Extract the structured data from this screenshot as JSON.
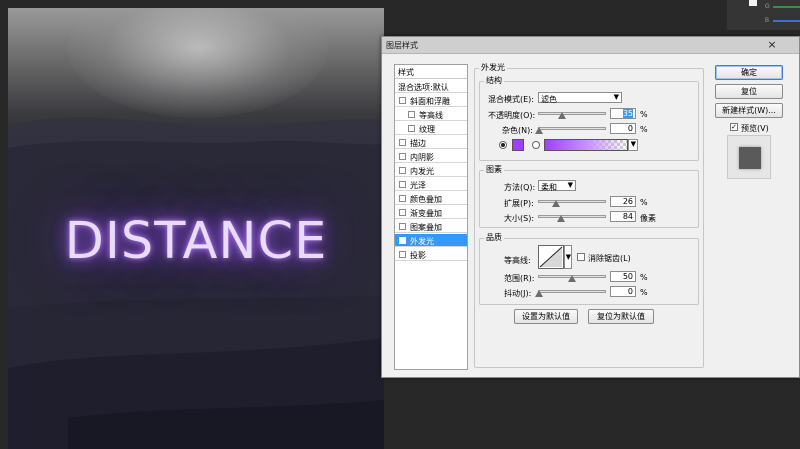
{
  "dialog": {
    "title": "图层样式",
    "close_glyph": "×"
  },
  "styles_panel": {
    "header": "样式",
    "items": [
      {
        "label": "混合选项:默认",
        "checked": false
      },
      {
        "label": "斜面和浮雕",
        "checked": false
      },
      {
        "label": "等高线",
        "checked": false
      },
      {
        "label": "纹理",
        "checked": false
      },
      {
        "label": "描边",
        "checked": false
      },
      {
        "label": "内阴影",
        "checked": false
      },
      {
        "label": "内发光",
        "checked": false
      },
      {
        "label": "光泽",
        "checked": false
      },
      {
        "label": "颜色叠加",
        "checked": false
      },
      {
        "label": "渐变叠加",
        "checked": false
      },
      {
        "label": "图案叠加",
        "checked": false
      },
      {
        "label": "外发光",
        "checked": true,
        "selected": true
      },
      {
        "label": "投影",
        "checked": false
      }
    ]
  },
  "outer_glow": {
    "title": "外发光",
    "structure": {
      "title": "结构",
      "blend_mode_label": "混合模式(E):",
      "blend_mode_value": "滤色",
      "opacity_label": "不透明度(O):",
      "opacity_value": "35",
      "opacity_fraction": 0.35,
      "noise_label": "杂色(N):",
      "noise_value": "0",
      "noise_fraction": 0.0,
      "percent": "%",
      "glow_color": "#a040ff"
    },
    "elements": {
      "title": "图素",
      "technique_label": "方法(Q):",
      "technique_value": "柔和",
      "spread_label": "扩展(P):",
      "spread_value": "26",
      "spread_fraction": 0.26,
      "size_label": "大小(S):",
      "size_value": "84",
      "size_fraction": 0.34,
      "percent": "%",
      "pixels": "像素"
    },
    "quality": {
      "title": "品质",
      "contour_label": "等高线:",
      "antialias_label": "消除锯齿(L)",
      "range_label": "范围(R):",
      "range_value": "50",
      "range_fraction": 0.5,
      "jitter_label": "抖动(J):",
      "jitter_value": "0",
      "jitter_fraction": 0.0,
      "percent": "%"
    },
    "make_default_label": "设置为默认值",
    "reset_default_label": "复位为默认值"
  },
  "buttons": {
    "ok": "确定",
    "reset": "复位",
    "new_style": "新建样式(W)...",
    "preview": "预览(V)"
  },
  "canvas": {
    "text": "DISTANCE"
  },
  "top_right": {
    "g_label": "G",
    "b_label": "B"
  }
}
